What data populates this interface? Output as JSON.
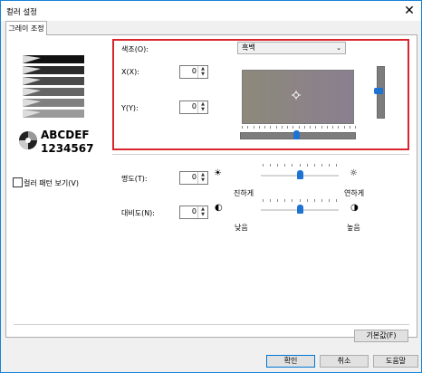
{
  "window": {
    "title": "컬러 설정",
    "close_glyph": "✕"
  },
  "tabs": [
    {
      "label": "그레이 조정"
    }
  ],
  "preview": {
    "line1": "ABCDEF",
    "line2": "1234567"
  },
  "tone": {
    "label": "색조(O):",
    "selected": "흑백",
    "x_label": "X(X):",
    "x_value": "0",
    "y_label": "Y(Y):",
    "y_value": "0"
  },
  "pattern_checkbox": {
    "label": "컬러 패턴 보기(V)",
    "checked": false
  },
  "brightness": {
    "label": "명도(T):",
    "value": "0",
    "left_caption": "진하게",
    "right_caption": "연하게",
    "level": 0.5
  },
  "contrast": {
    "label": "대비도(N):",
    "value": "0",
    "left_caption": "낮음",
    "right_caption": "높음",
    "level": 0.5
  },
  "buttons": {
    "defaults": "기본값(F)",
    "ok": "확인",
    "cancel": "취소",
    "help": "도움말"
  },
  "colors": {
    "accent": "#1e73d2",
    "highlight_frame": "#d9262e"
  }
}
